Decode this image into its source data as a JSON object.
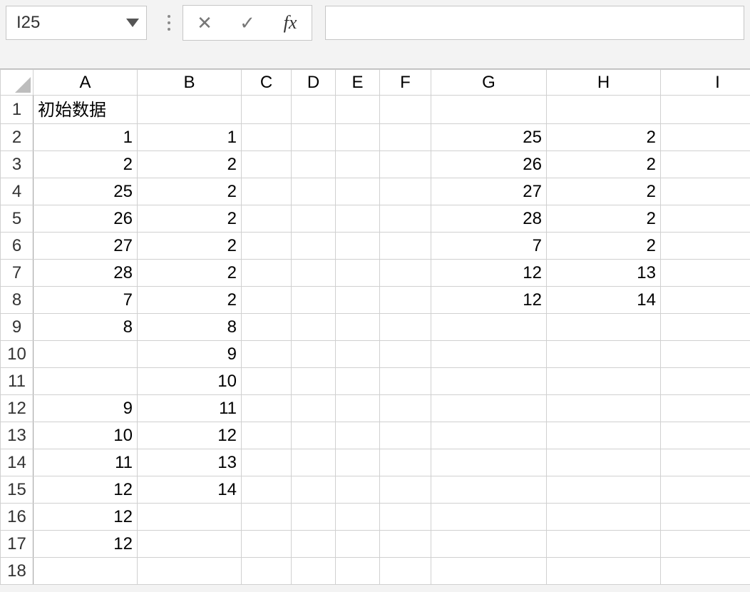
{
  "formula_bar": {
    "name_box": "I25",
    "cancel_glyph": "✕",
    "confirm_glyph": "✓",
    "fx_label": "fx",
    "formula_value": "",
    "formula_placeholder": ""
  },
  "columns": [
    "A",
    "B",
    "C",
    "D",
    "E",
    "F",
    "G",
    "H",
    "I"
  ],
  "row_count": 18,
  "cells": {
    "A1": {
      "v": "初始数据",
      "align": "left"
    },
    "A2": {
      "v": "1"
    },
    "B2": {
      "v": "1"
    },
    "G2": {
      "v": "25"
    },
    "H2": {
      "v": "2"
    },
    "A3": {
      "v": "2"
    },
    "B3": {
      "v": "2"
    },
    "G3": {
      "v": "26"
    },
    "H3": {
      "v": "2"
    },
    "A4": {
      "v": "25"
    },
    "B4": {
      "v": "2"
    },
    "G4": {
      "v": "27"
    },
    "H4": {
      "v": "2"
    },
    "A5": {
      "v": "26"
    },
    "B5": {
      "v": "2"
    },
    "G5": {
      "v": "28"
    },
    "H5": {
      "v": "2"
    },
    "A6": {
      "v": "27"
    },
    "B6": {
      "v": "2"
    },
    "G6": {
      "v": "7"
    },
    "H6": {
      "v": "2"
    },
    "A7": {
      "v": "28"
    },
    "B7": {
      "v": "2"
    },
    "G7": {
      "v": "12"
    },
    "H7": {
      "v": "13"
    },
    "A8": {
      "v": "7"
    },
    "B8": {
      "v": "2"
    },
    "G8": {
      "v": "12"
    },
    "H8": {
      "v": "14"
    },
    "A9": {
      "v": "8"
    },
    "B9": {
      "v": "8"
    },
    "B10": {
      "v": "9"
    },
    "B11": {
      "v": "10"
    },
    "A12": {
      "v": "9"
    },
    "B12": {
      "v": "11"
    },
    "A13": {
      "v": "10"
    },
    "B13": {
      "v": "12"
    },
    "A14": {
      "v": "11"
    },
    "B14": {
      "v": "13"
    },
    "A15": {
      "v": "12"
    },
    "B15": {
      "v": "14"
    },
    "A16": {
      "v": "12"
    },
    "A17": {
      "v": "12"
    }
  }
}
